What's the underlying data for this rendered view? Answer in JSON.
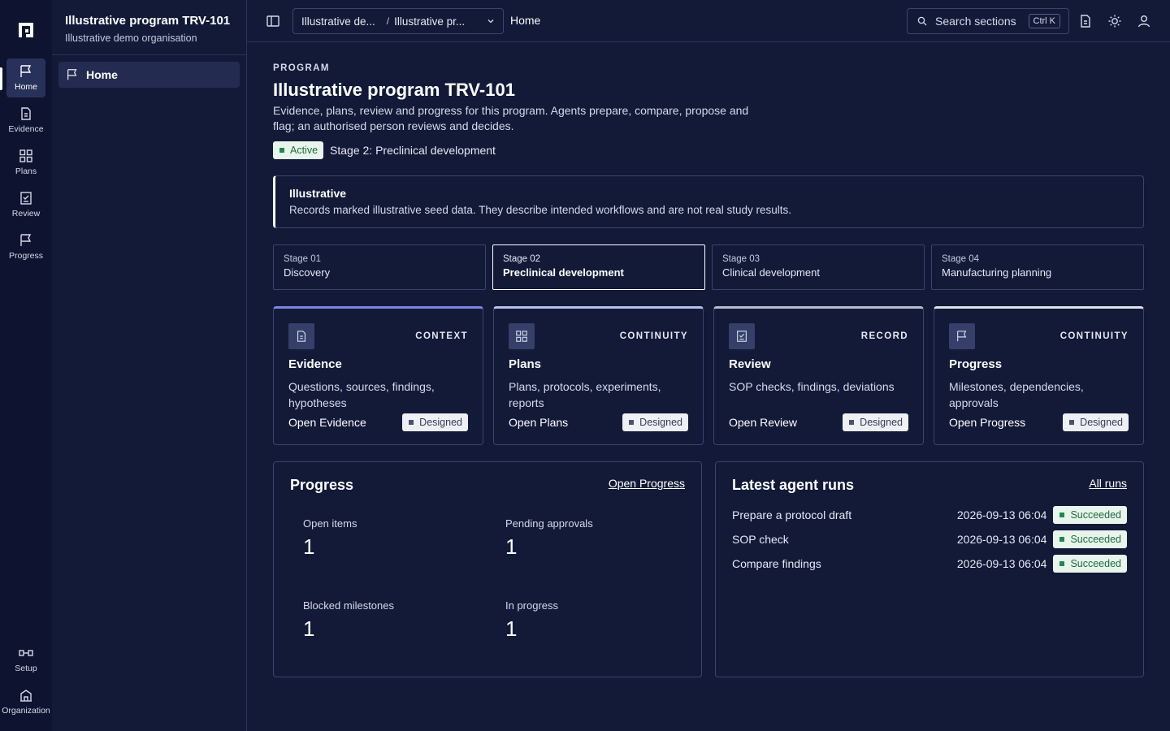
{
  "rail": {
    "logo_icon": "app-logo",
    "items": [
      {
        "label": "Home",
        "icon": "flag-icon"
      },
      {
        "label": "Evidence",
        "icon": "document-icon"
      },
      {
        "label": "Plans",
        "icon": "grid-icon"
      },
      {
        "label": "Review",
        "icon": "checklist-icon"
      },
      {
        "label": "Progress",
        "icon": "flag-icon"
      }
    ],
    "bottom": [
      {
        "label": "Setup",
        "icon": "setup-icon"
      },
      {
        "label": "Organization",
        "icon": "building-icon"
      }
    ]
  },
  "sidebar": {
    "title": "Illustrative program TRV-101",
    "subtitle": "Illustrative demo organisation",
    "nav": [
      {
        "label": "Home",
        "icon": "flag-icon"
      }
    ]
  },
  "topbar": {
    "crumb_org": "Illustrative de...",
    "crumb_program": "Illustrative pr...",
    "page": "Home",
    "search_placeholder": "Search sections",
    "shortcut": "Ctrl K"
  },
  "main": {
    "eyebrow": "PROGRAM",
    "title": "Illustrative program TRV-101",
    "description": "Evidence, plans, review and progress for this program. Agents prepare, compare, propose and flag; an authorised person reviews and decides.",
    "status": "Active",
    "stage": "Stage 2: Preclinical development",
    "notice": {
      "title": "Illustrative",
      "body": "Records marked illustrative seed data. They describe intended workflows and are not real study results."
    },
    "stages": [
      {
        "num": "Stage 01",
        "name": "Discovery"
      },
      {
        "num": "Stage 02",
        "name": "Preclinical development"
      },
      {
        "num": "Stage 03",
        "name": "Clinical development"
      },
      {
        "num": "Stage 04",
        "name": "Manufacturing planning"
      }
    ],
    "cards": [
      {
        "category": "CONTEXT",
        "title": "Evidence",
        "desc": "Questions, sources, findings, hypotheses",
        "link": "Open Evidence",
        "badge": "Designed",
        "icon": "document-icon",
        "accent": "#7c85e0"
      },
      {
        "category": "CONTINUITY",
        "title": "Plans",
        "desc": "Plans, protocols, experiments, reports",
        "link": "Open Plans",
        "badge": "Designed",
        "icon": "grid-icon",
        "accent": "#b7c0ec"
      },
      {
        "category": "RECORD",
        "title": "Review",
        "desc": "SOP checks, findings, deviations",
        "link": "Open Review",
        "badge": "Designed",
        "icon": "checklist-icon",
        "accent": "#b6bccc"
      },
      {
        "category": "CONTINUITY",
        "title": "Progress",
        "desc": "Milestones, dependencies, approvals",
        "link": "Open Progress",
        "badge": "Designed",
        "icon": "flag-icon",
        "accent": "#dfe2ea"
      }
    ],
    "progress": {
      "title": "Progress",
      "link": "Open Progress",
      "metrics": [
        {
          "label": "Open items",
          "value": "1"
        },
        {
          "label": "Pending approvals",
          "value": "1"
        },
        {
          "label": "Blocked milestones",
          "value": "1"
        },
        {
          "label": "In progress",
          "value": "1"
        }
      ]
    },
    "runs": {
      "title": "Latest agent runs",
      "link": "All runs",
      "items": [
        {
          "name": "Prepare a protocol draft",
          "time": "2026-09-13 06:04",
          "status": "Succeeded"
        },
        {
          "name": "SOP check",
          "time": "2026-09-13 06:04",
          "status": "Succeeded"
        },
        {
          "name": "Compare findings",
          "time": "2026-09-13 06:04",
          "status": "Succeeded"
        }
      ]
    }
  },
  "colors": {
    "background": "#121a38",
    "rail": "#0e1430",
    "success_bg": "#e8f5ec",
    "success_fg": "#1d6b3c",
    "designed_square": "#4a5270"
  }
}
